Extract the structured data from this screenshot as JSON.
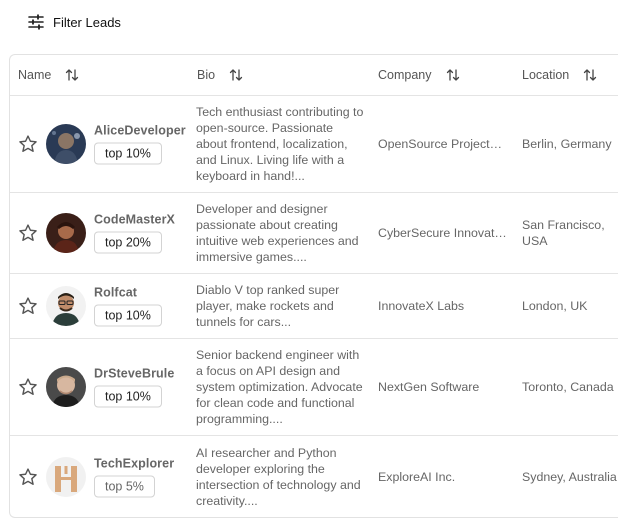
{
  "toolbar": {
    "filter_label": "Filter Leads",
    "filter_icon": "sliders-icon"
  },
  "table": {
    "headers": [
      {
        "label": "Name",
        "key": "name"
      },
      {
        "label": "Bio",
        "key": "bio"
      },
      {
        "label": "Company",
        "key": "company"
      },
      {
        "label": "Location",
        "key": "location"
      }
    ],
    "rows": [
      {
        "name": "AliceDeveloper",
        "rank": "top 10%",
        "bio": "Tech enthusiast contributing to open-source. Passionate about frontend, localization, and Linux. Living life with a keyboard in hand!...",
        "company": "OpenSource Projects Inc.",
        "location": "Berlin, Germany",
        "avatar": "avatar-alice"
      },
      {
        "name": "CodeMasterX",
        "rank": "top 20%",
        "bio": "Developer and designer passionate about creating intuitive web experiences and immersive games....",
        "company": "CyberSecure Innovations",
        "location": "San Francisco, USA",
        "avatar": "avatar-codemaster"
      },
      {
        "name": "Rolfcat",
        "rank": "top 10%",
        "bio": "Diablo V top ranked super player, make rockets and tunnels for cars...",
        "company": "InnovateX Labs",
        "location": "London, UK",
        "avatar": "avatar-rolfcat"
      },
      {
        "name": "DrSteveBrule",
        "rank": "top 10%",
        "bio": "Senior backend engineer with a focus on API design and system optimization. Advocate for clean code and functional programming....",
        "company": "NextGen Software",
        "location": "Toronto, Canada",
        "avatar": "avatar-drsteve"
      },
      {
        "name": "TechExplorer",
        "rank": "top 5%",
        "bio": "AI researcher and Python developer exploring the intersection of technology and creativity....",
        "company": "ExploreAI Inc.",
        "location": "Sydney, Australia",
        "avatar": "avatar-techexplorer"
      }
    ]
  }
}
